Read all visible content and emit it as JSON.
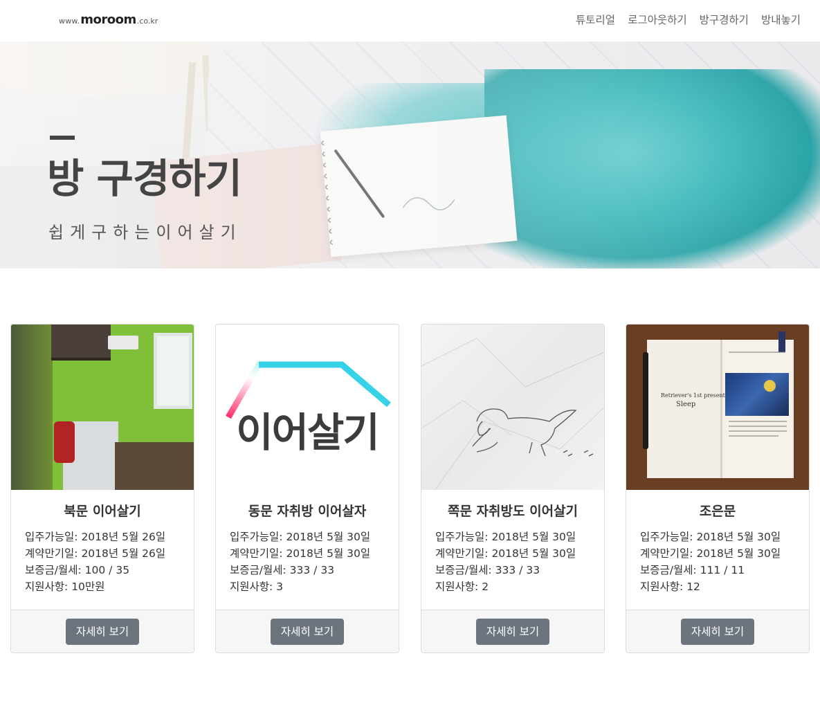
{
  "brand": {
    "www": "www.",
    "name": "moroom",
    "tld": ".co.kr"
  },
  "nav": {
    "items": [
      {
        "label": "튜토리얼"
      },
      {
        "label": "로그아웃하기"
      },
      {
        "label": "방구경하기"
      },
      {
        "label": "방내놓기"
      }
    ]
  },
  "hero": {
    "title": "방 구경하기",
    "subtitle": "쉽게구하는이어살기"
  },
  "cards": [
    {
      "title": "북문 이어살기",
      "move_in": "입주가능일: 2018년 5월 26일",
      "expiry": "계약만기일: 2018년 5월 26일",
      "deposit": "보증금/월세: 100 / 35",
      "support": "지원사항: 10만원",
      "button": "자세히 보기"
    },
    {
      "title": "동문 자취방 이어살자",
      "move_in": "입주가능일: 2018년 5월 30일",
      "expiry": "계약만기일: 2018년 5월 30일",
      "deposit": "보증금/월세: 333 / 33",
      "support": "지원사항: 3",
      "button": "자세히 보기"
    },
    {
      "title": "쪽문 자취방도 이어살기",
      "move_in": "입주가능일: 2018년 5월 30일",
      "expiry": "계약만기일: 2018년 5월 30일",
      "deposit": "보증금/월세: 333 / 33",
      "support": "지원사항: 2",
      "button": "자세히 보기"
    },
    {
      "title": "조은문",
      "move_in": "입주가능일: 2018년 5월 30일",
      "expiry": "계약만기일: 2018년 5월 30일",
      "deposit": "보증금/월세: 111 / 11",
      "support": "지원사항: 12",
      "button": "자세히 보기"
    }
  ],
  "images": {
    "logo_text": "이어살기",
    "book_left_1": "Retriever's 1st present",
    "book_left_2": "Sleep"
  },
  "colors": {
    "button": "#6c757d",
    "logo_roof_cyan": "#36d3e8",
    "logo_roof_pink": "#ff2e6a",
    "logo_text": "#3c3c3c"
  }
}
